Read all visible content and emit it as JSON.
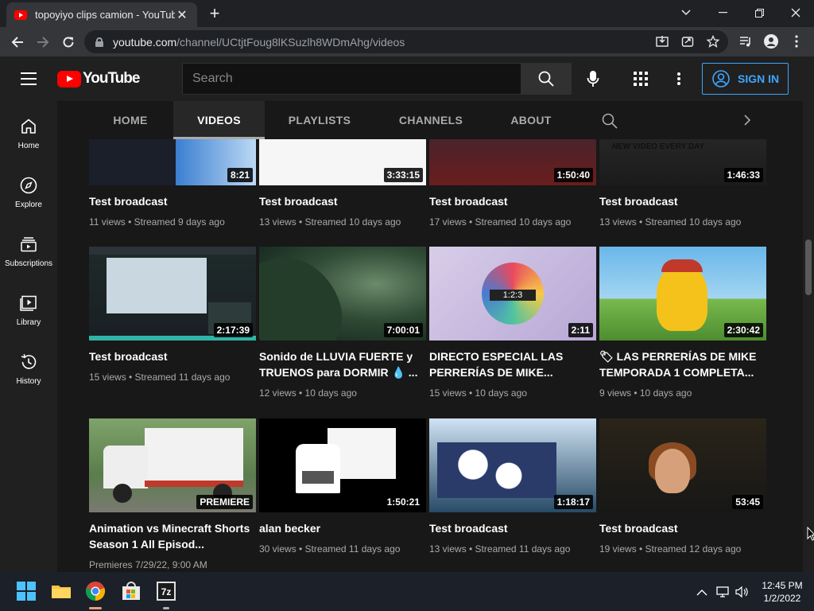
{
  "browser": {
    "tab_title": "topoyiyo clips camion - YouTube",
    "url_host": "youtube.com",
    "url_path": "/channel/UCtjtFoug8lKSuzlh8WDmAhg/videos"
  },
  "masthead": {
    "logo_text": "YouTube",
    "search_placeholder": "Search",
    "signin_label": "SIGN IN"
  },
  "guide": {
    "items": [
      {
        "label": "Home",
        "icon": "home-icon"
      },
      {
        "label": "Explore",
        "icon": "compass-icon"
      },
      {
        "label": "Subscriptions",
        "icon": "subscriptions-icon"
      },
      {
        "label": "Library",
        "icon": "library-icon"
      },
      {
        "label": "History",
        "icon": "history-icon"
      }
    ]
  },
  "channel_tabs": [
    "HOME",
    "VIDEOS",
    "PLAYLISTS",
    "CHANNELS",
    "ABOUT"
  ],
  "active_tab": "VIDEOS",
  "videos": [
    {
      "title": "Test broadcast",
      "meta": "11 views • Streamed 9 days ago",
      "duration": "8:21"
    },
    {
      "title": "Test broadcast",
      "meta": "13 views • Streamed 10 days ago",
      "duration": "3:33:15"
    },
    {
      "title": "Test broadcast",
      "meta": "17 views • Streamed 10 days ago",
      "duration": "1:50:40"
    },
    {
      "title": "Test broadcast",
      "meta": "13 views • Streamed 10 days ago",
      "duration": "1:46:33",
      "thumb_text": "NEW VIDEO EVERY DAY"
    },
    {
      "title": "Test broadcast",
      "meta": "15 views • Streamed 11 days ago",
      "duration": "2:17:39"
    },
    {
      "title": "Sonido de LLUVIA FUERTE y TRUENOS para DORMIR 💧 ...",
      "meta": "12 views • 10 days ago",
      "duration": "7:00:01"
    },
    {
      "title": "DIRECTO ESPECIAL LAS PERRERÍAS DE MIKE...",
      "meta": "15 views • 10 days ago",
      "duration": "2:11",
      "thumb_text": "1:2:3"
    },
    {
      "title": "🏷 LAS PERRERÍAS DE MIKE TEMPORADA 1 COMPLETA...",
      "meta": "9 views • 10 days ago",
      "duration": "2:30:42"
    },
    {
      "title": "Animation vs Minecraft Shorts Season 1 All Episod...",
      "meta": "Premieres 7/29/22, 9:00 AM",
      "duration": "PREMIERE"
    },
    {
      "title": "alan becker",
      "meta": "30 views • Streamed 11 days ago",
      "duration": "1:50:21"
    },
    {
      "title": "Test broadcast",
      "meta": "13 views • Streamed 11 days ago",
      "duration": "1:18:17"
    },
    {
      "title": "Test broadcast",
      "meta": "19 views • Streamed 12 days ago",
      "duration": "53:45"
    }
  ],
  "taskbar": {
    "time": "12:45 PM",
    "date": "1/2/2022"
  }
}
